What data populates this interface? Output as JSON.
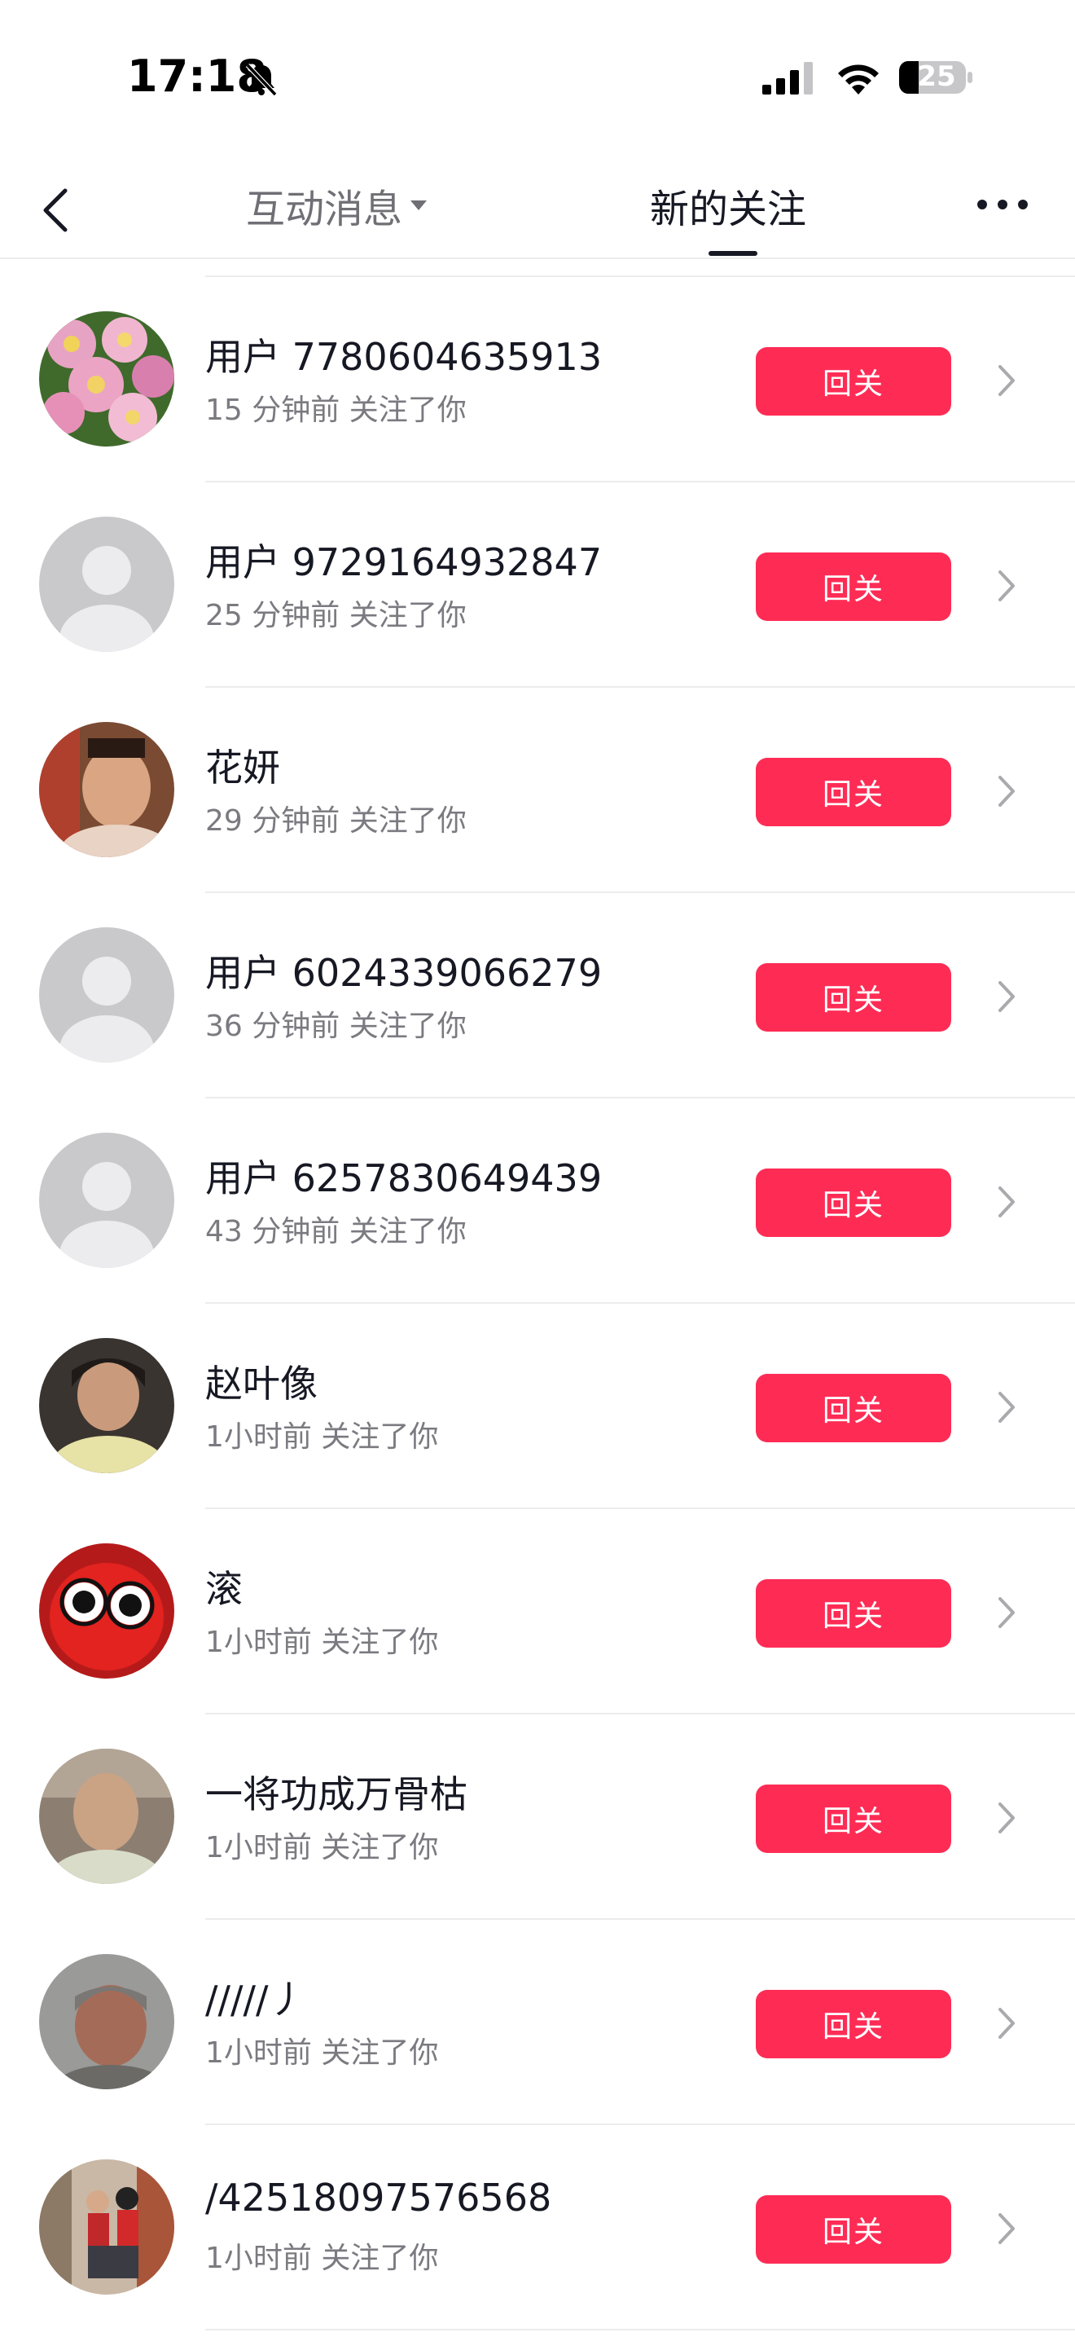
{
  "status_bar": {
    "time": "17:18",
    "battery": "25",
    "icons": [
      "bell-slash-icon",
      "cellular-signal-icon",
      "wifi-icon",
      "battery-icon"
    ]
  },
  "nav": {
    "tab_interactions": "互动消息",
    "tab_new_followers": "新的关注",
    "icons": [
      "back-chevron-icon",
      "caret-down-icon",
      "more-dots-icon"
    ]
  },
  "colors": {
    "accent": "#fe2c55",
    "text_primary": "#161823",
    "text_secondary": "#7a7a80",
    "divider": "#ececec"
  },
  "followers": [
    {
      "name": "用户 7780604635913",
      "meta": "15 分钟前 关注了你",
      "button": "回关",
      "avatar": "flowers-photo"
    },
    {
      "name": "用户 9729164932847",
      "meta": "25 分钟前 关注了你",
      "button": "回关",
      "avatar": "default-avatar"
    },
    {
      "name": "花妍",
      "meta": "29 分钟前 关注了你",
      "button": "回关",
      "avatar": "person-photo"
    },
    {
      "name": "用户 6024339066279",
      "meta": "36 分钟前 关注了你",
      "button": "回关",
      "avatar": "default-avatar"
    },
    {
      "name": "用户 6257830649439",
      "meta": "43 分钟前 关注了你",
      "button": "回关",
      "avatar": "default-avatar"
    },
    {
      "name": "赵叶像",
      "meta": "1小时前 关注了你",
      "button": "回关",
      "avatar": "person-photo"
    },
    {
      "name": "滚",
      "meta": "1小时前 关注了你",
      "button": "回关",
      "avatar": "red-octopus-toy-photo"
    },
    {
      "name": "一将功成万骨枯",
      "meta": "1小时前 关注了你",
      "button": "回关",
      "avatar": "person-photo"
    },
    {
      "name": "/////丿",
      "meta": "1小时前 关注了你",
      "button": "回关",
      "avatar": "person-photo"
    },
    {
      "name": "/42518097576568",
      "meta": "1小时前 关注了你",
      "button": "回关",
      "avatar": "two-people-photo"
    }
  ]
}
